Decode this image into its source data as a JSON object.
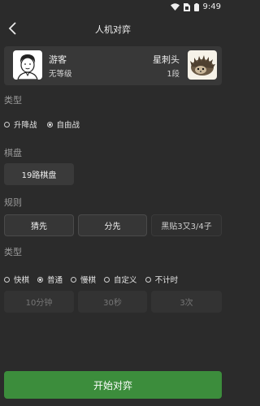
{
  "status": {
    "time": "9:49"
  },
  "header": {
    "title": "人机对弈"
  },
  "players": {
    "left": {
      "name": "游客",
      "rank": "无等级"
    },
    "right": {
      "name": "星刺头",
      "rank": "1段"
    }
  },
  "type_section": {
    "label": "类型",
    "options": [
      "升降战",
      "自由战"
    ],
    "selected": "自由战"
  },
  "board_section": {
    "label": "棋盘",
    "value": "19路棋盘"
  },
  "rules_section": {
    "label": "规则",
    "guess": "猜先",
    "split": "分先",
    "komi": "黑贴3又3/4子"
  },
  "time_section": {
    "label": "类型",
    "options": [
      "快棋",
      "普通",
      "慢棋",
      "自定义",
      "不计时"
    ],
    "selected": "普通",
    "main_time": "10分钟",
    "byoyomi": "30秒",
    "periods": "3次"
  },
  "start_button": "开始对弈"
}
